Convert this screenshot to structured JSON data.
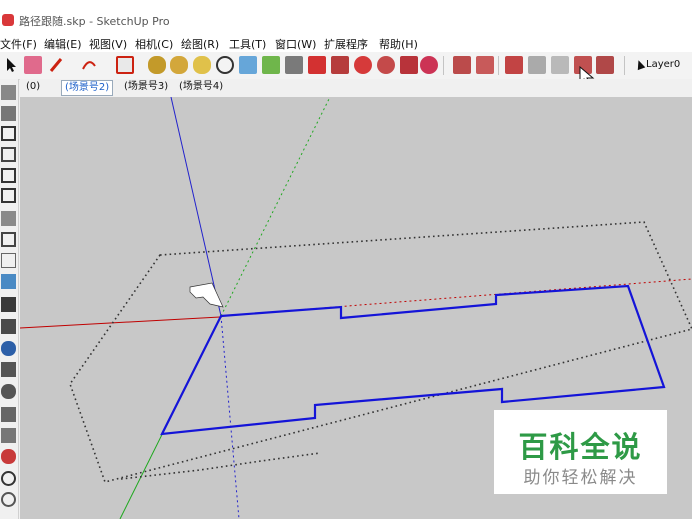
{
  "window": {
    "title": "路径跟随.skp - SketchUp Pro"
  },
  "menu": {
    "items": [
      "文件(F)",
      "编辑(E)",
      "视图(V)",
      "相机(C)",
      "绘图(R)",
      "工具(T)",
      "窗口(W)",
      "扩展程序",
      "帮助(H)"
    ]
  },
  "toolbar": {
    "layer": "Layer0"
  },
  "scenes": {
    "tabs": [
      "(0)",
      "(场景号2)",
      "(场景号3)",
      "(场景号4)"
    ],
    "active_index": 1
  },
  "watermark": {
    "title": "百科全说",
    "subtitle": "助你轻松解决"
  },
  "colors": {
    "path": "#1414d8",
    "axis_red": "#c00000",
    "axis_green": "#1ea81e",
    "axis_blue": "#2222cc",
    "guide_box": "#333333",
    "watermark_green": "#2e9a46",
    "canvas_background": "#c8c8c8"
  }
}
